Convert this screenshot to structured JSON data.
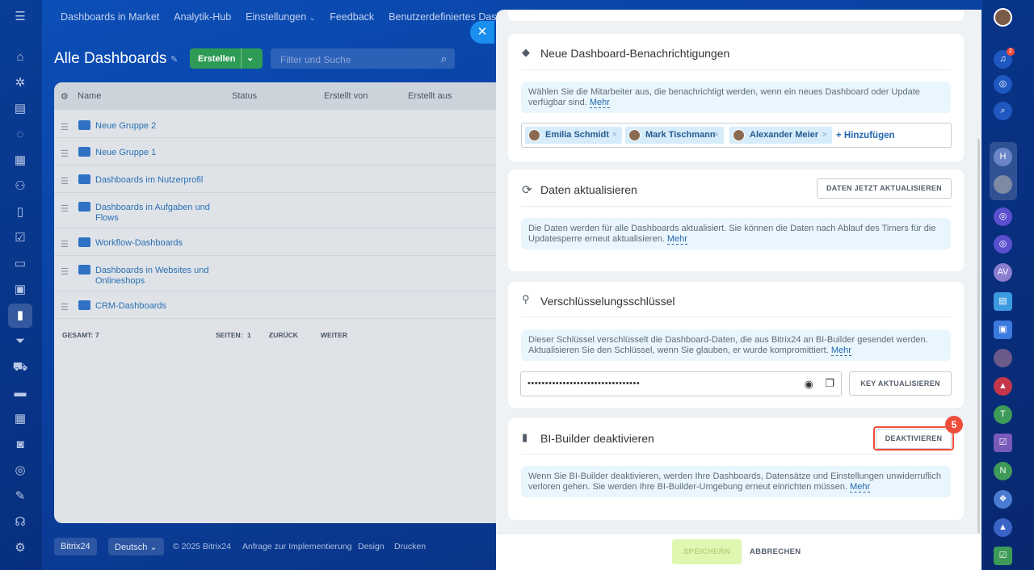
{
  "topnav": [
    "Dashboards in Market",
    "Analytik-Hub",
    "Einstellungen",
    "Feedback",
    "Benutzerdefiniertes Dashboa"
  ],
  "page": {
    "title": "Alle Dashboards",
    "create_label": "Erstellen",
    "filter_placeholder": "Filter und Suche"
  },
  "grid": {
    "columns": [
      "Name",
      "Status",
      "Erstellt von",
      "Erstellt aus"
    ],
    "rows": [
      "Neue Gruppe 2",
      "Neue Gruppe 1",
      "Dashboards im Nutzerprofil",
      "Dashboards in Aufgaben und Flows",
      "Workflow-Dashboards",
      "Dashboards in Websites und Onlineshops",
      "CRM-Dashboards"
    ],
    "total_label": "GESAMT:",
    "total_value": "7",
    "pages_label": "SEITEN:",
    "pages_value": "1",
    "prev_label": "ZURÜCK",
    "next_label": "WEITER"
  },
  "bottombar": {
    "brand": "Bitrix24",
    "language": "Deutsch",
    "copyright": "© 2025 Bitrix24",
    "links": [
      "Anfrage zur Implementierung",
      "Design",
      "Drucken"
    ]
  },
  "slider": {
    "notifications": {
      "title": "Neue Dashboard-Benachrichtigungen",
      "note": "Wählen Sie die Mitarbeiter aus, die benachrichtigt werden, wenn ein neues Dashboard oder Update verfügbar sind.",
      "more": "Mehr",
      "users": [
        "Emilia Schmidt",
        "Mark Tischmann",
        "Alexander Meier"
      ],
      "add_label": "+ Hinzufügen"
    },
    "refresh": {
      "title": "Daten aktualisieren",
      "button": "DATEN JETZT AKTUALISIEREN",
      "note": "Die Daten werden für alle Dashboards aktualisiert. Sie können die Daten nach Ablauf des Timers für die Updatesperre erneut aktualisieren.",
      "more": "Mehr"
    },
    "key": {
      "title": "Verschlüsselungsschlüssel",
      "note": "Dieser Schlüssel verschlüsselt die Dashboard-Daten, die aus Bitrix24 an BI-Builder gesendet werden. Aktualisieren Sie den Schlüssel, wenn Sie glauben, er wurde kompromittiert.",
      "more": "Mehr",
      "masked": "••••••••••••••••••••••••••••••••",
      "button": "KEY AKTUALISIEREN"
    },
    "deactivate": {
      "title": "BI-Builder deaktivieren",
      "button": "DEAKTIVIEREN",
      "step": "5",
      "note": "Wenn Sie BI-Builder deaktivieren, werden Ihre Dashboards, Datensätze und Einstellungen unwiderruflich verloren gehen. Sie werden Ihre BI-Builder-Umgebung erneut einrichten müssen.",
      "more": "Mehr"
    },
    "save_label": "SPEICHERN",
    "cancel_label": "ABBRECHEN"
  },
  "rightbar": {
    "notification_count": "2",
    "avatars": [
      "H",
      "AV",
      "T",
      "N"
    ]
  },
  "colors": {
    "accent": "#2066b0",
    "highlight": "#ef4d3c",
    "create": "#2e9b55"
  }
}
